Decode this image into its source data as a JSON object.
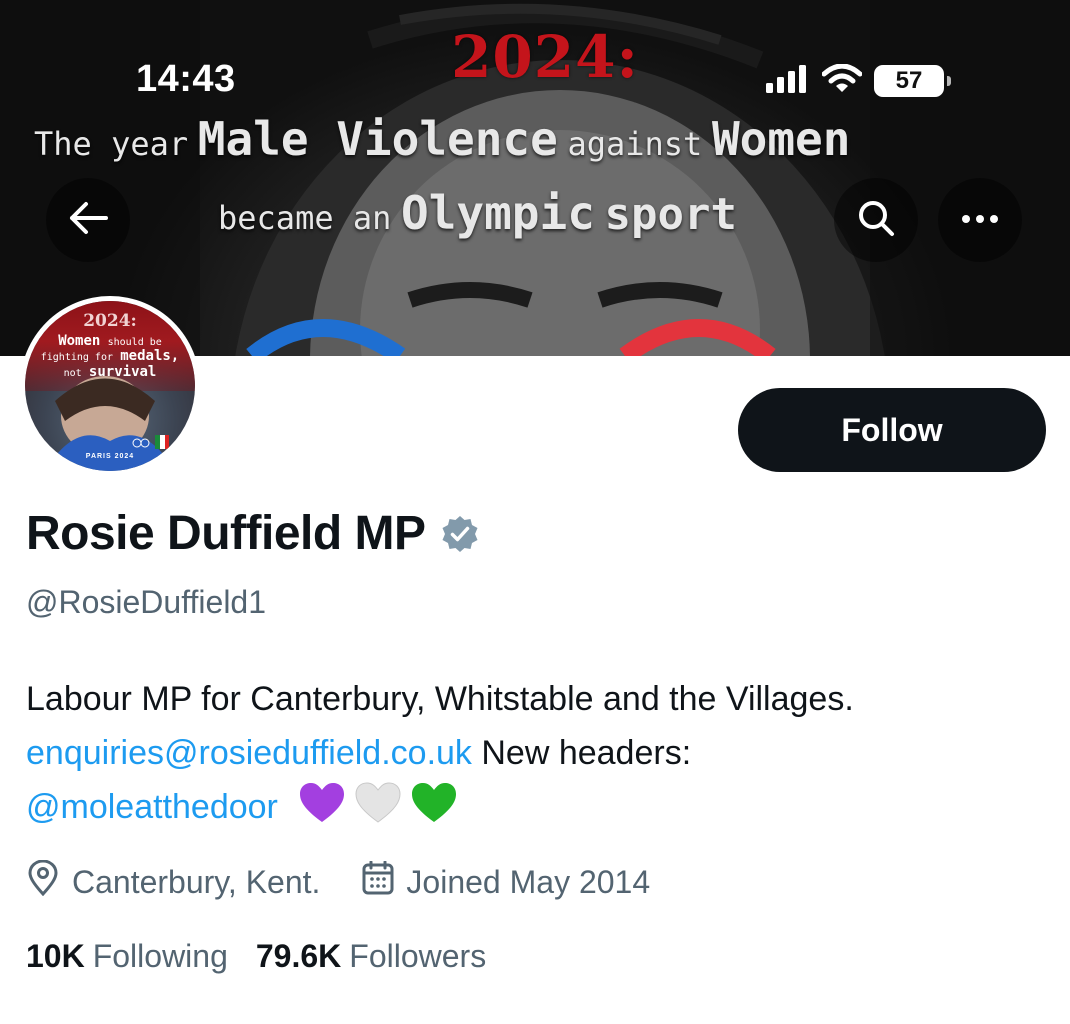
{
  "status_bar": {
    "time": "14:43",
    "battery": "57"
  },
  "banner": {
    "year": "2024:",
    "line1_a": "The year",
    "line1_b": "Male Violence",
    "line1_c": "against",
    "line1_d": "Women",
    "line2_a": "became an",
    "line2_b": "Olympic",
    "line2_c": "sport"
  },
  "avatar": {
    "year": "2024:",
    "line1_a": "Women",
    "line1_b": "should be",
    "line2_a": "fighting for",
    "line2_b": "medals,",
    "line3_a": "not",
    "line3_b": "survival",
    "footer": "PARIS 2024"
  },
  "follow_button": {
    "label": "Follow"
  },
  "profile": {
    "name": "Rosie Duffield MP",
    "handle": "@RosieDuffield1",
    "bio_text": "Labour MP for Canterbury, Whitstable and the Villages.",
    "bio_email": "enquiries@rosieduffield.co.uk",
    "bio_headers": " New headers:",
    "bio_mention": "@moleatthedoor",
    "location": "Canterbury, Kent.",
    "joined": "Joined May 2014",
    "following_count": "10K",
    "following_label": "Following",
    "followers_count": "79.6K",
    "followers_label": "Followers"
  },
  "colors": {
    "link": "#1d9bf0",
    "secondary_text": "#536471",
    "primary_text": "#0f1419",
    "verified_badge": "#829aab",
    "banner_red": "#c4141b"
  },
  "icons": [
    "back-arrow-icon",
    "search-icon",
    "more-icon",
    "signal-icon",
    "wifi-icon",
    "battery-icon",
    "verified-badge-icon",
    "location-pin-icon",
    "calendar-icon"
  ]
}
